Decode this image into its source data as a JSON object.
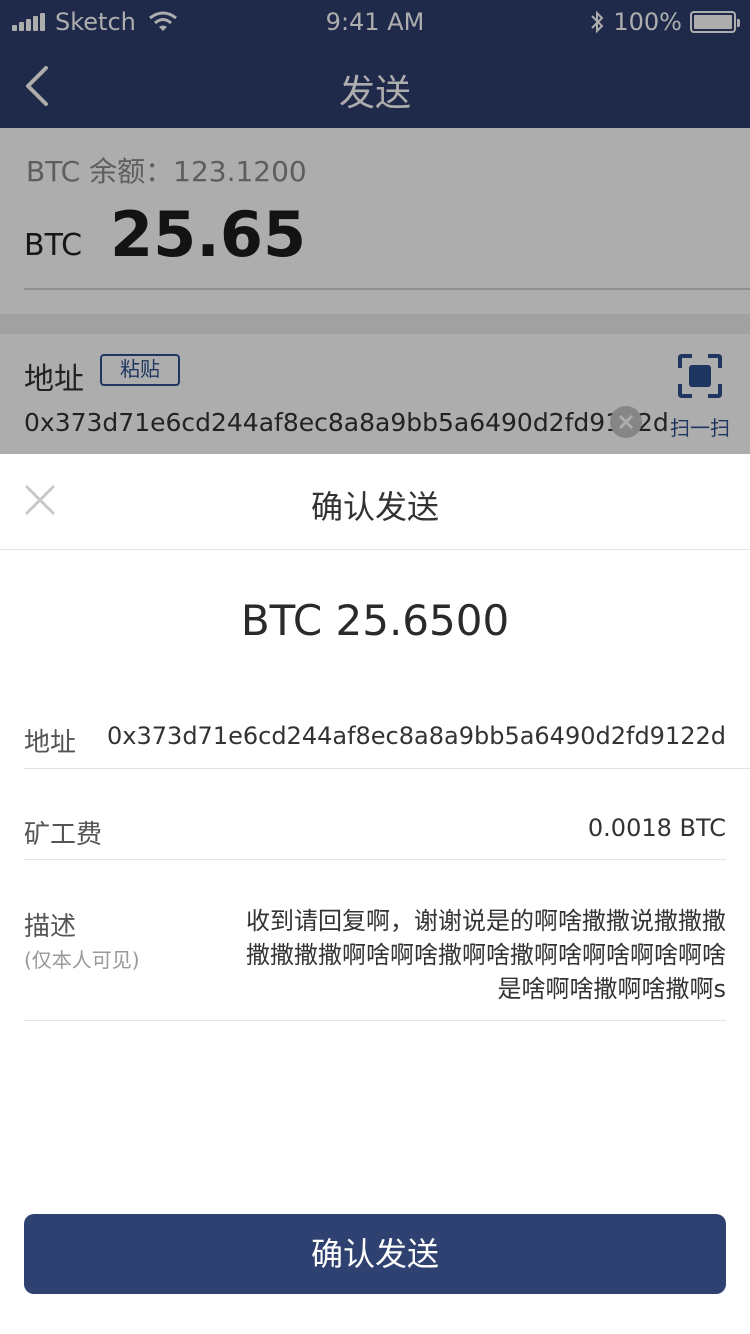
{
  "status": {
    "carrier": "Sketch",
    "time": "9:41 AM",
    "battery": "100%"
  },
  "nav": {
    "title": "发送",
    "back_icon": "chevron-left-icon"
  },
  "balance": {
    "label": "BTC 余额：123.1200",
    "unit": "BTC",
    "amount": "25.65"
  },
  "address_section": {
    "label": "地址",
    "paste_label": "粘贴",
    "address": "0x373d71e6cd244af8ec8a8a9bb5a6490d2fd9122d",
    "scan_label": "扫一扫"
  },
  "sheet": {
    "title": "确认发送",
    "amount": "BTC 25.6500",
    "rows": {
      "address_label": "地址",
      "address_value": "0x373d71e6cd244af8ec8a8a9bb5a6490d2fd9122d",
      "fee_label": "矿工费",
      "fee_value": "0.0018 BTC",
      "desc_label": "描述",
      "desc_sub": "(仅本人可见)",
      "desc_value": "收到请回复啊，谢谢说是的啊啥撒撒说撒撒撒撒撒撒撒啊啥啊啥撒啊啥撒啊啥啊啥啊啥啊啥是啥啊啥撒啊啥撒啊s"
    },
    "confirm_label": "确认发送"
  },
  "colors": {
    "nav_bg": "#2f3f6f",
    "accent": "#2f4f8f",
    "button_bg": "#2f4170"
  }
}
